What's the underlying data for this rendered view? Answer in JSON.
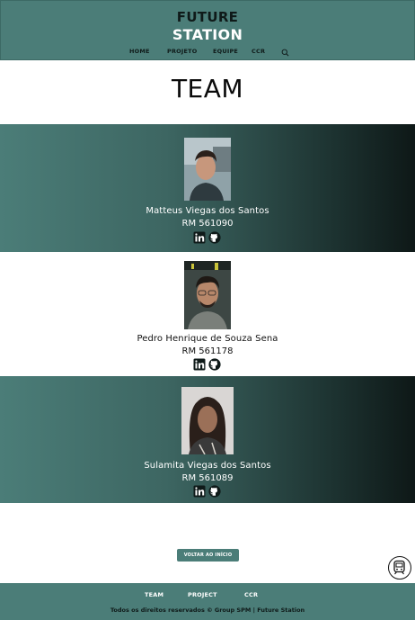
{
  "header": {
    "logo_line1": "FUTURE",
    "logo_line2": "STATION",
    "nav": [
      "HOME",
      "PROJETO",
      "EQUIPE",
      "CCR"
    ]
  },
  "page_title": "TEAM",
  "members": [
    {
      "name": "Matteus Viegas dos Santos",
      "rm": "RM 561090"
    },
    {
      "name": "Pedro Henrique de Souza Sena",
      "rm": "RM 561178"
    },
    {
      "name": "Sulamita Viegas dos Santos",
      "rm": "RM 561089"
    }
  ],
  "back_button": "VOLTAR AO INÍCIO",
  "footer": {
    "nav": [
      "TEAM",
      "PROJECT",
      "CCR"
    ],
    "copyright": "Todos os direitos reservados © Group SPM | Future Station"
  },
  "colors": {
    "brand": "#4b7d78",
    "dark": "#0e1817"
  },
  "icons": [
    "search-icon",
    "linkedin-icon",
    "github-icon",
    "train-icon"
  ]
}
